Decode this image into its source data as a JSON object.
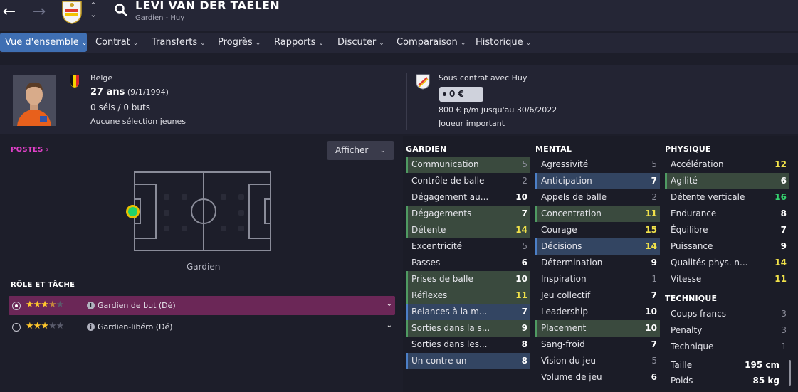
{
  "player": {
    "name": "LEVI VAN DER TAELEN",
    "subtitle": "Gardien - Huy"
  },
  "menu": [
    {
      "label": "Vue d'ensemble",
      "active": true
    },
    {
      "label": "Contrat"
    },
    {
      "label": "Transferts"
    },
    {
      "label": "Progrès"
    },
    {
      "label": "Rapports"
    },
    {
      "label": "Discuter"
    },
    {
      "label": "Comparaison"
    },
    {
      "label": "Historique"
    }
  ],
  "profile": {
    "nationality": "Belge",
    "age": "27 ans",
    "birthdate": "(9/1/1994)",
    "caps": "0 séls / 0 buts",
    "youth": "Aucune sélection jeunes"
  },
  "contract": {
    "club_line": "Sous contrat avec Huy",
    "value": "0 €",
    "wage": "800 € p/m jusqu'au 30/6/2022",
    "status": "Joueur important"
  },
  "positions": {
    "header": "POSTES",
    "afficher": "Afficher",
    "position_label": "Gardien"
  },
  "roles": {
    "header": "RÔLE ET TÂCHE",
    "items": [
      {
        "name": "Gardien de but (Dé)",
        "stars": 3.5,
        "selected": true
      },
      {
        "name": "Gardien-libéro (Dé)",
        "stars": 3,
        "selected": false
      }
    ]
  },
  "attributes": {
    "gardien": {
      "header": "GARDIEN",
      "rows": [
        {
          "label": "Communication",
          "value": "5",
          "hl": "g"
        },
        {
          "label": "Contrôle de balle",
          "value": "2"
        },
        {
          "label": "Dégagement au...",
          "value": "10"
        },
        {
          "label": "Dégagements",
          "value": "7",
          "hl": "g"
        },
        {
          "label": "Détente",
          "value": "14",
          "hl": "g"
        },
        {
          "label": "Excentricité",
          "value": "5"
        },
        {
          "label": "Passes",
          "value": "6"
        },
        {
          "label": "Prises de balle",
          "value": "10",
          "hl": "g"
        },
        {
          "label": "Réflexes",
          "value": "11",
          "hl": "g"
        },
        {
          "label": "Relances à la m...",
          "value": "7",
          "hl": "b"
        },
        {
          "label": "Sorties dans la s...",
          "value": "9",
          "hl": "g"
        },
        {
          "label": "Sorties dans les...",
          "value": "8"
        },
        {
          "label": "Un contre un",
          "value": "8",
          "hl": "b"
        }
      ]
    },
    "mental": {
      "header": "MENTAL",
      "rows": [
        {
          "label": "Agressivité",
          "value": "5"
        },
        {
          "label": "Anticipation",
          "value": "7",
          "hl": "b"
        },
        {
          "label": "Appels de balle",
          "value": "2"
        },
        {
          "label": "Concentration",
          "value": "11",
          "hl": "g"
        },
        {
          "label": "Courage",
          "value": "15"
        },
        {
          "label": "Décisions",
          "value": "14",
          "hl": "b"
        },
        {
          "label": "Détermination",
          "value": "9"
        },
        {
          "label": "Inspiration",
          "value": "1"
        },
        {
          "label": "Jeu collectif",
          "value": "7"
        },
        {
          "label": "Leadership",
          "value": "10"
        },
        {
          "label": "Placement",
          "value": "10",
          "hl": "g"
        },
        {
          "label": "Sang-froid",
          "value": "7"
        },
        {
          "label": "Vision du jeu",
          "value": "5"
        },
        {
          "label": "Volume de jeu",
          "value": "6"
        }
      ]
    },
    "physique": {
      "header": "PHYSIQUE",
      "rows": [
        {
          "label": "Accélération",
          "value": "12"
        },
        {
          "label": "Agilité",
          "value": "6",
          "hl": "g"
        },
        {
          "label": "Détente verticale",
          "value": "16"
        },
        {
          "label": "Endurance",
          "value": "8"
        },
        {
          "label": "Équilibre",
          "value": "7"
        },
        {
          "label": "Puissance",
          "value": "9"
        },
        {
          "label": "Qualités phys. n...",
          "value": "14"
        },
        {
          "label": "Vitesse",
          "value": "11"
        }
      ]
    },
    "technique": {
      "header": "TECHNIQUE",
      "rows": [
        {
          "label": "Coups francs",
          "value": "3"
        },
        {
          "label": "Penalty",
          "value": "3"
        },
        {
          "label": "Technique",
          "value": "1"
        }
      ]
    },
    "measures": [
      {
        "label": "Taille",
        "value": "195 cm"
      },
      {
        "label": "Poids",
        "value": "85 kg"
      }
    ]
  },
  "colors": {
    "accent": "#3f6fb3",
    "role_selected": "#6b2757",
    "good": "#4f9a62",
    "key": "#4c7fc7"
  }
}
